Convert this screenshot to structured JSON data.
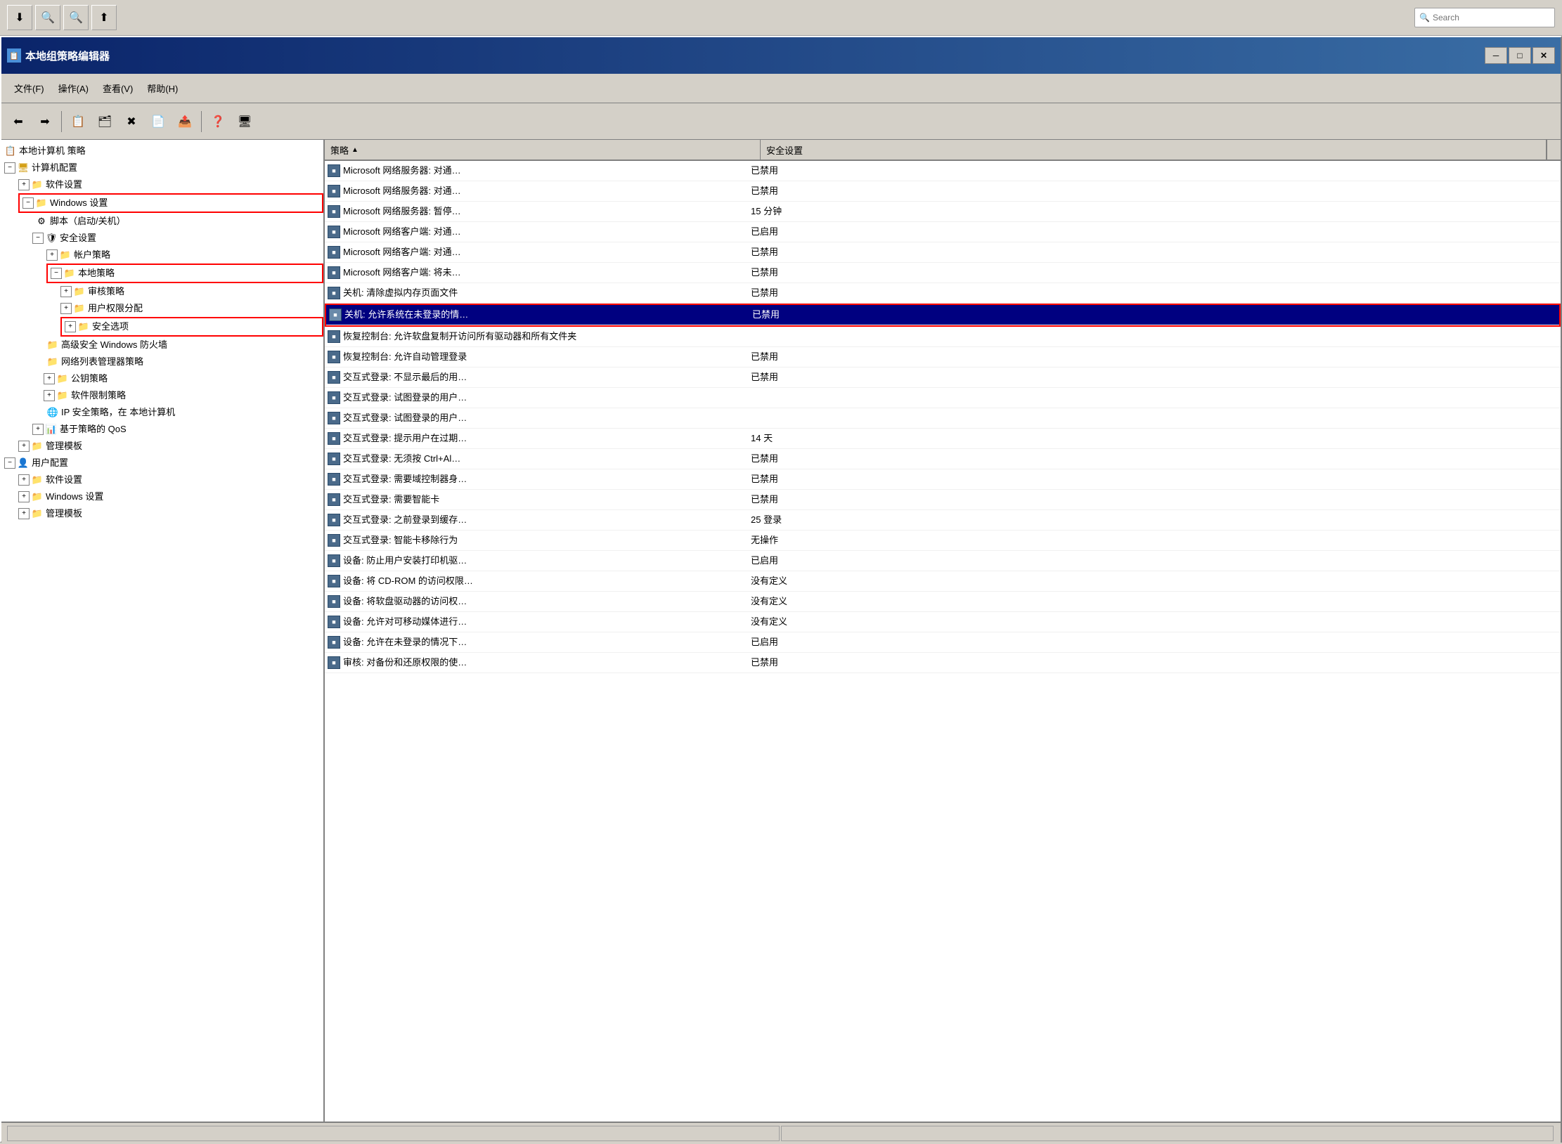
{
  "os_toolbar": {
    "search_placeholder": "Search"
  },
  "title_bar": {
    "title": "本地组策略编辑器",
    "minimize": "─",
    "restore": "□",
    "close": "✕"
  },
  "menu": {
    "items": [
      {
        "label": "文件(F)"
      },
      {
        "label": "操作(A)"
      },
      {
        "label": "查看(V)"
      },
      {
        "label": "帮助(H)"
      }
    ]
  },
  "tree": {
    "root": "本地计算机 策略",
    "nodes": [
      {
        "id": "computer-config",
        "label": "计算机配置",
        "level": 0,
        "expanded": true,
        "icon": "computer"
      },
      {
        "id": "software-settings",
        "label": "软件设置",
        "level": 1,
        "expanded": false,
        "icon": "folder"
      },
      {
        "id": "windows-settings",
        "label": "Windows 设置",
        "level": 1,
        "expanded": true,
        "icon": "folder",
        "highlighted": true
      },
      {
        "id": "scripts",
        "label": "脚本（启动/关机）",
        "level": 2,
        "expanded": false,
        "icon": "script"
      },
      {
        "id": "security-settings",
        "label": "安全设置",
        "level": 2,
        "expanded": true,
        "icon": "security"
      },
      {
        "id": "account-policy",
        "label": "帐户策略",
        "level": 3,
        "expanded": false,
        "icon": "folder"
      },
      {
        "id": "local-policy",
        "label": "本地策略",
        "level": 3,
        "expanded": true,
        "icon": "folder",
        "highlighted": true
      },
      {
        "id": "audit-policy",
        "label": "审核策略",
        "level": 4,
        "expanded": false,
        "icon": "folder"
      },
      {
        "id": "user-rights",
        "label": "用户权限分配",
        "level": 4,
        "expanded": false,
        "icon": "folder"
      },
      {
        "id": "security-options",
        "label": "安全选项",
        "level": 4,
        "expanded": false,
        "icon": "folder",
        "highlighted": true
      },
      {
        "id": "firewall",
        "label": "高级安全 Windows 防火墙",
        "level": 3,
        "expanded": false,
        "icon": "folder"
      },
      {
        "id": "network-list",
        "label": "网络列表管理器策略",
        "level": 3,
        "expanded": false,
        "icon": "folder"
      },
      {
        "id": "public-key",
        "label": "公钥策略",
        "level": 3,
        "expanded": false,
        "icon": "folder"
      },
      {
        "id": "software-restrict",
        "label": "软件限制策略",
        "level": 3,
        "expanded": false,
        "icon": "folder"
      },
      {
        "id": "ip-security",
        "label": "IP 安全策略，在 本地计算机",
        "level": 3,
        "expanded": false,
        "icon": "ip"
      },
      {
        "id": "qos",
        "label": "基于策略的 QoS",
        "level": 2,
        "expanded": false,
        "icon": "chart"
      },
      {
        "id": "admin-templates1",
        "label": "管理模板",
        "level": 1,
        "expanded": false,
        "icon": "folder"
      },
      {
        "id": "user-config",
        "label": "用户配置",
        "level": 0,
        "expanded": true,
        "icon": "user"
      },
      {
        "id": "user-software",
        "label": "软件设置",
        "level": 1,
        "expanded": false,
        "icon": "folder"
      },
      {
        "id": "user-windows",
        "label": "Windows 设置",
        "level": 1,
        "expanded": false,
        "icon": "folder"
      },
      {
        "id": "user-admin",
        "label": "管理模板",
        "level": 1,
        "expanded": false,
        "icon": "folder"
      }
    ]
  },
  "right_panel": {
    "columns": [
      {
        "label": "策略",
        "sort": "asc"
      },
      {
        "label": "安全设置"
      }
    ],
    "policies": [
      {
        "name": "Microsoft 网络服务器: 对通…",
        "value": "已禁用",
        "selected": false
      },
      {
        "name": "Microsoft 网络服务器: 对通…",
        "value": "已禁用",
        "selected": false
      },
      {
        "name": "Microsoft 网络服务器: 暂停…",
        "value": "15 分钟",
        "selected": false
      },
      {
        "name": "Microsoft 网络客户端: 对通…",
        "value": "已启用",
        "selected": false
      },
      {
        "name": "Microsoft 网络客户端: 对通…",
        "value": "已禁用",
        "selected": false
      },
      {
        "name": "Microsoft 网络客户端: 将未…",
        "value": "已禁用",
        "selected": false
      },
      {
        "name": "关机: 清除虚拟内存页面文件",
        "value": "已禁用",
        "selected": false
      },
      {
        "name": "关机: 允许系统在未登录的情…",
        "value": "已禁用",
        "selected": true
      },
      {
        "name": "恢复控制台: 允许软盘复制开访问所有驱动器和所有文件夹",
        "value": "",
        "selected": false
      },
      {
        "name": "恢复控制台: 允许自动管理登录",
        "value": "已禁用",
        "selected": false
      },
      {
        "name": "交互式登录: 不显示最后的用…",
        "value": "已禁用",
        "selected": false
      },
      {
        "name": "交互式登录: 试图登录的用户…",
        "value": "",
        "selected": false
      },
      {
        "name": "交互式登录: 试图登录的用户…",
        "value": "",
        "selected": false
      },
      {
        "name": "交互式登录: 提示用户在过期…",
        "value": "14 天",
        "selected": false
      },
      {
        "name": "交互式登录: 无须按 Ctrl+Al…",
        "value": "已禁用",
        "selected": false
      },
      {
        "name": "交互式登录: 需要域控制器身…",
        "value": "已禁用",
        "selected": false
      },
      {
        "name": "交互式登录: 需要智能卡",
        "value": "已禁用",
        "selected": false
      },
      {
        "name": "交互式登录: 之前登录到缓存…",
        "value": "25 登录",
        "selected": false
      },
      {
        "name": "交互式登录: 智能卡移除行为",
        "value": "无操作",
        "selected": false
      },
      {
        "name": "设备: 防止用户安装打印机驱…",
        "value": "已启用",
        "selected": false
      },
      {
        "name": "设备: 将 CD-ROM 的访问权限…",
        "value": "没有定义",
        "selected": false
      },
      {
        "name": "设备: 将软盘驱动器的访问权…",
        "value": "没有定义",
        "selected": false
      },
      {
        "name": "设备: 允许对可移动媒体进行…",
        "value": "没有定义",
        "selected": false
      },
      {
        "name": "设备: 允许在未登录的情况下…",
        "value": "已启用",
        "selected": false
      },
      {
        "name": "审核: 对备份和还原权限的使…",
        "value": "已禁用",
        "selected": false
      }
    ]
  },
  "status": {
    "text": ""
  }
}
